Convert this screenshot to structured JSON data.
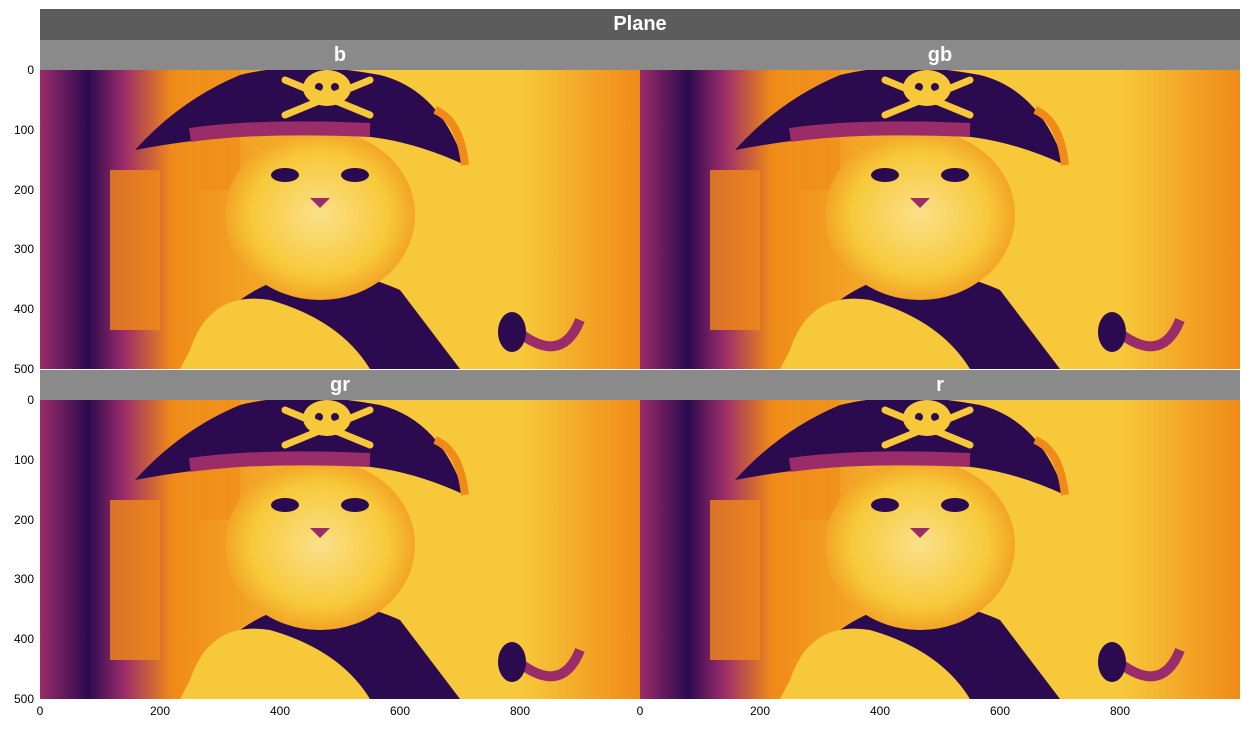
{
  "figure": {
    "title": "Plane"
  },
  "chart_data": {
    "type": "heatmap",
    "title": "Plane",
    "colormap": "inferno",
    "panels": [
      {
        "name": "b"
      },
      {
        "name": "gb"
      },
      {
        "name": "gr"
      },
      {
        "name": "r"
      }
    ],
    "x_range": [
      0,
      1000
    ],
    "y_range": [
      0,
      500
    ],
    "x_ticks": [
      "0",
      "200",
      "400",
      "600",
      "800"
    ],
    "y_ticks": [
      "0",
      "100",
      "200",
      "300",
      "400",
      "500"
    ],
    "grid": false,
    "description_colors": {
      "dark": "#2b0a4f",
      "mid": "#9b2c6a",
      "orange": "#f08a18",
      "yellow": "#f7c93a",
      "light": "#fbe08a"
    }
  }
}
